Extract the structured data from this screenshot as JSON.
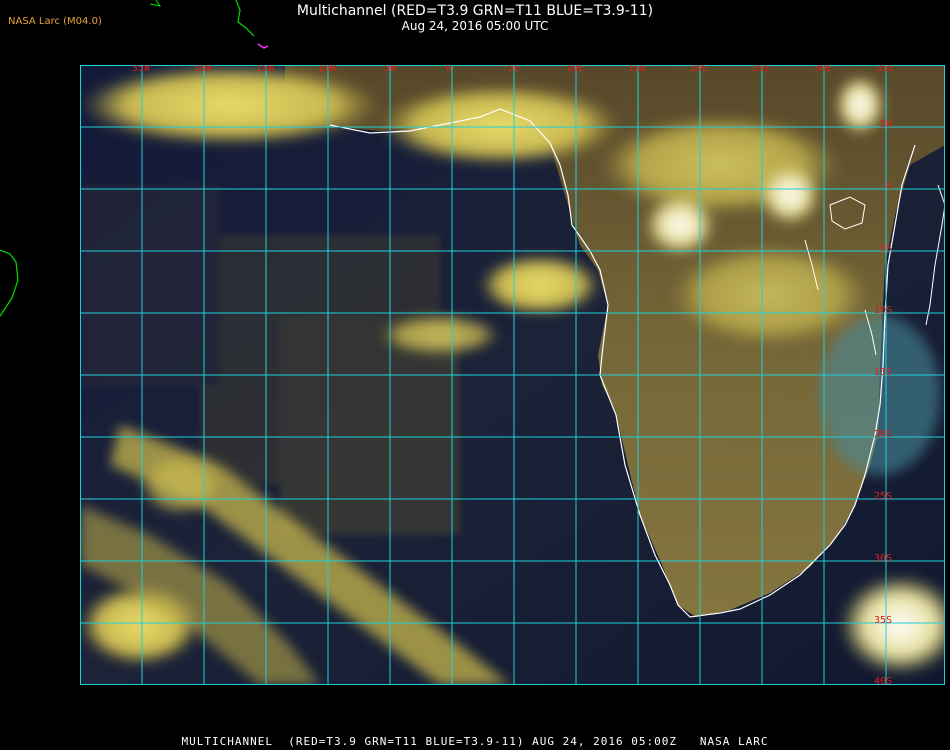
{
  "header": {
    "credit": "NASA Larc (M04.0)",
    "title": "Multichannel (RED=T3.9 GRN=T11 BLUE=T3.9-11)",
    "timestamp": "Aug 24, 2016 05:00 UTC"
  },
  "footer": {
    "caption": "MULTICHANNEL  (RED=T3.9 GRN=T11 BLUE=T3.9-11) AUG 24, 2016 05:00Z   NASA LARC"
  },
  "map": {
    "longitude_labels": [
      "35W",
      "30W",
      "15W",
      "10W",
      "5W",
      "0",
      "5E",
      "10E",
      "15E",
      "20E",
      "25E",
      "30E",
      "35E"
    ],
    "latitude_labels": [
      "5N",
      "0",
      "5S",
      "10S",
      "15S",
      "20S",
      "25S",
      "30S",
      "35S",
      "40S"
    ],
    "colors": {
      "grid": "#20d0d8",
      "coastline": "#ffffff",
      "lat_lon_labels": "#e02020",
      "outside_coast": "#00e000",
      "credit": "#e8a23a",
      "ocean_clear": "#161d3c",
      "land": "#6a5a2e",
      "cloud_low": "#d8cc5a",
      "cloud_high": "#e8f0f0"
    }
  }
}
